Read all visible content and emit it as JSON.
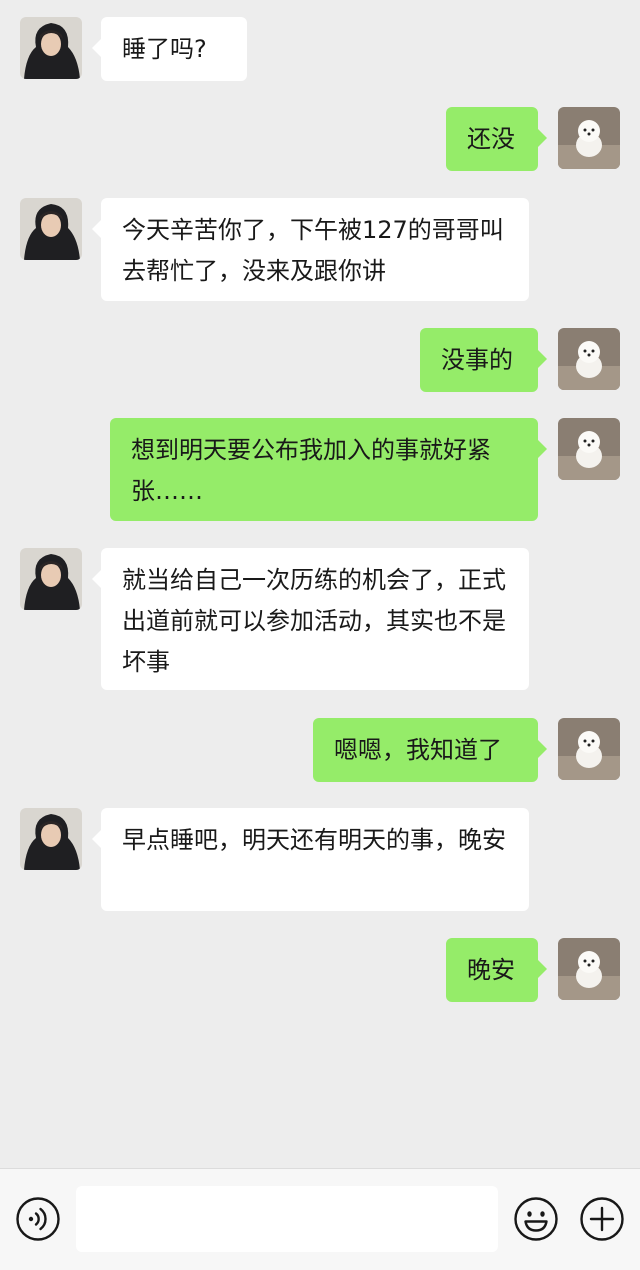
{
  "chat": {
    "messages": [
      {
        "side": "left",
        "text": "睡了吗?"
      },
      {
        "side": "right",
        "text": "还没"
      },
      {
        "side": "left",
        "text": "今天辛苦你了，下午被127的哥哥叫去帮忙了，没来及跟你讲"
      },
      {
        "side": "right",
        "text": "没事的"
      },
      {
        "side": "right",
        "text": "想到明天要公布我加入的事就好紧张……"
      },
      {
        "side": "left",
        "text": "就当给自己一次历练的机会了，正式出道前就可以参加活动，其实也不是坏事"
      },
      {
        "side": "right",
        "text": "嗯嗯，我知道了"
      },
      {
        "side": "left",
        "text": "早点睡吧，明天还有明天的事，晚安"
      },
      {
        "side": "right",
        "text": "晚安"
      }
    ]
  },
  "input_bar": {
    "icons": {
      "voice": "voice-icon",
      "emoji": "emoji-icon",
      "more": "plus-icon"
    },
    "message_value": ""
  },
  "colors": {
    "background": "#ededed",
    "bubble_left": "#ffffff",
    "bubble_right": "#95ec69",
    "text": "#191919",
    "icon": "#181818"
  }
}
